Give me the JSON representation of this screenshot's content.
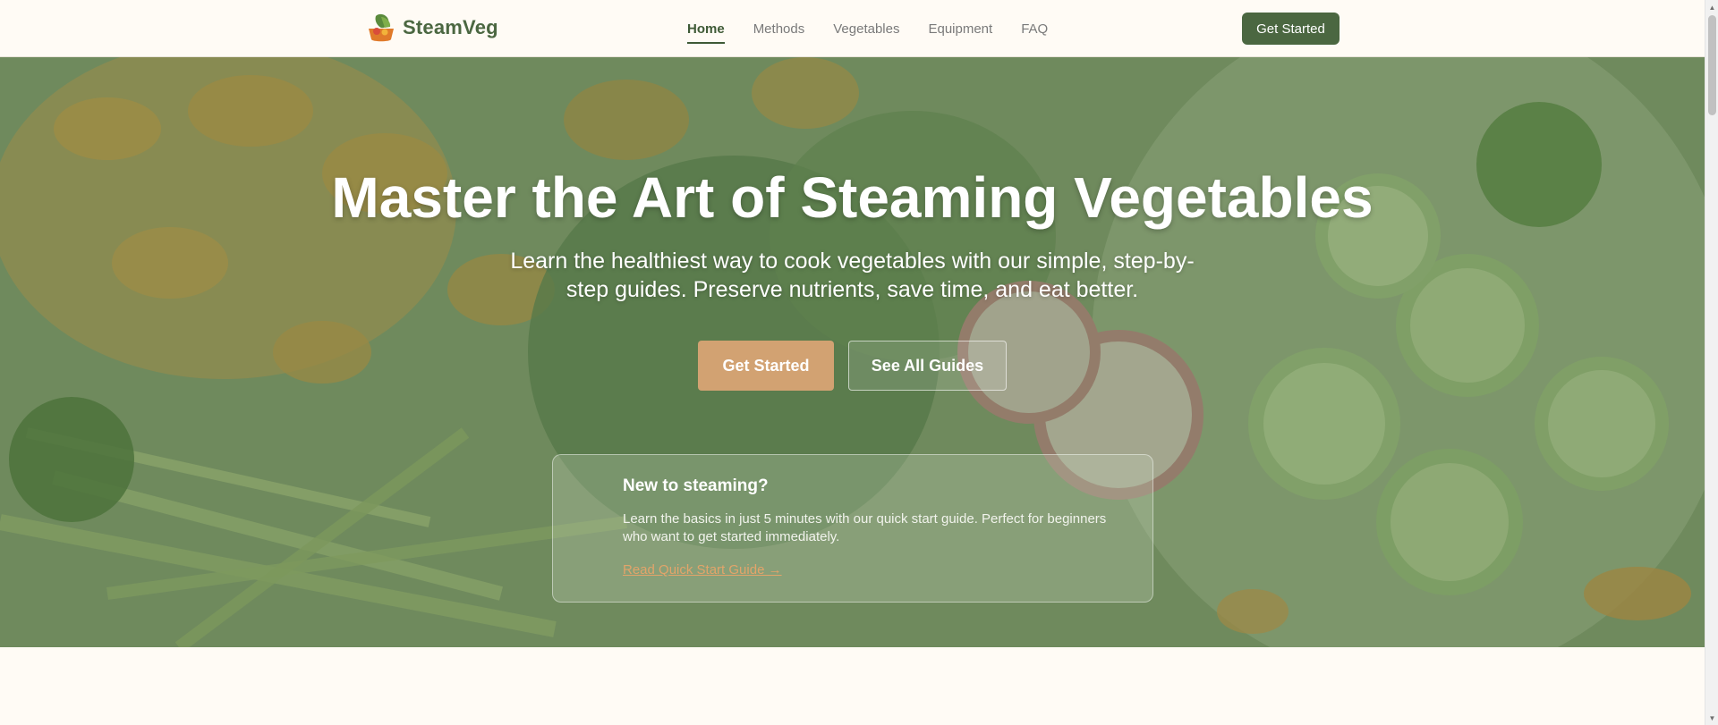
{
  "header": {
    "brand_name": "SteamVeg",
    "nav": [
      {
        "label": "Home",
        "active": true
      },
      {
        "label": "Methods"
      },
      {
        "label": "Vegetables"
      },
      {
        "label": "Equipment"
      },
      {
        "label": "FAQ"
      }
    ],
    "cta_label": "Get Started"
  },
  "hero": {
    "title": "Master the Art of Steaming Vegetables",
    "subtitle": "Learn the healthiest way to cook vegetables with our simple, step-by-step guides. Preserve nutrients, save time, and eat better.",
    "primary_button": "Get Started",
    "secondary_button": "See All Guides",
    "card": {
      "title": "New to steaming?",
      "text": "Learn the basics in just 5 minutes with our quick start guide. Perfect for beginners who want to get started immediately.",
      "link": "Read Quick Start Guide →"
    }
  },
  "colors": {
    "brand_green": "#4b6741",
    "accent_orange": "#d2a272",
    "page_background": "#fffbf5"
  },
  "icons": {
    "logo": "vegetable-basket-icon",
    "scroll_up": "triangle-up",
    "scroll_down": "triangle-down"
  }
}
